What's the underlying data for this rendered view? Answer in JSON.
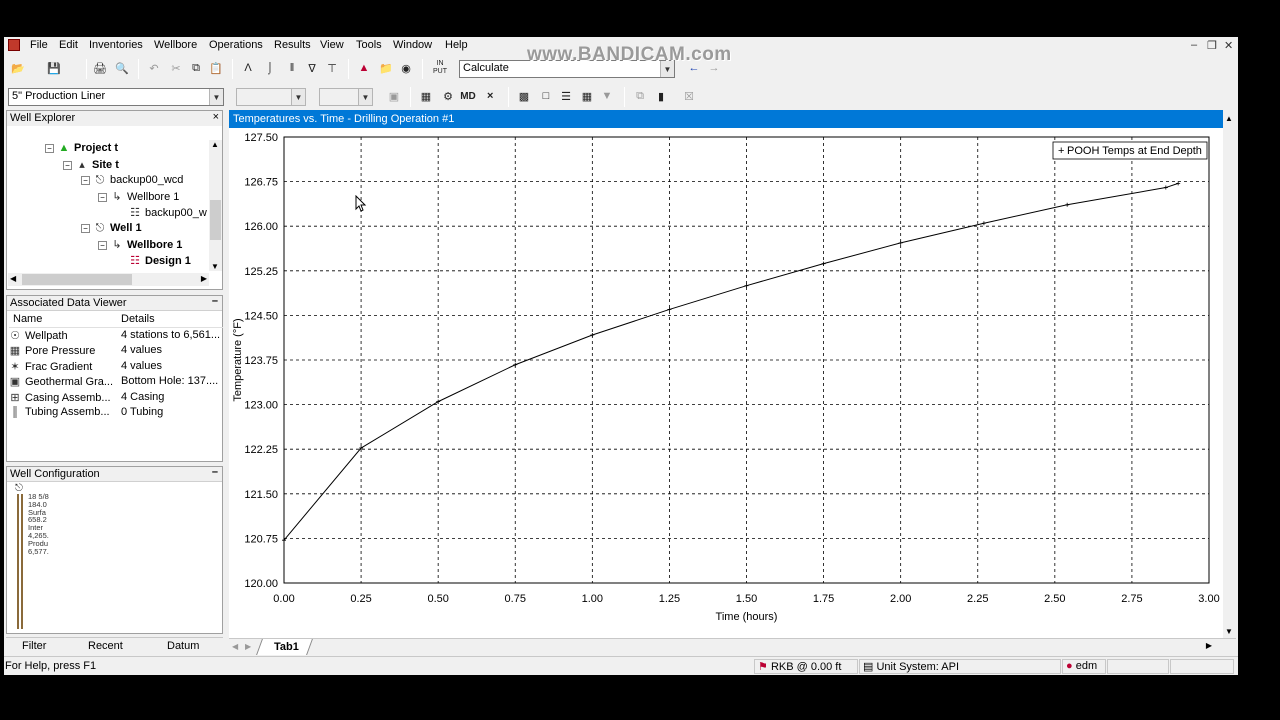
{
  "watermark": "www.BANDICAM.com",
  "menu": [
    "File",
    "Edit",
    "Inventories",
    "Wellbore",
    "Operations",
    "Results",
    "View",
    "Tools",
    "Window",
    "Help"
  ],
  "toolbar": {
    "calc_combo": "Calculate",
    "design_combo": "5\" Production Liner",
    "empty_combo_1": "",
    "empty_combo_2": "",
    "input_label": "IN PUT",
    "md_label": "MD"
  },
  "well_explorer": {
    "title": "Well Explorer",
    "nodes": [
      {
        "label": "Project t",
        "bold": true
      },
      {
        "label": "Site t",
        "bold": true
      },
      {
        "label": "backup00_wcd",
        "bold": false
      },
      {
        "label": "Wellbore 1",
        "bold": false
      },
      {
        "label": "backup00_w",
        "bold": false
      },
      {
        "label": "Well 1",
        "bold": true
      },
      {
        "label": "Wellbore 1",
        "bold": true
      },
      {
        "label": "Design 1",
        "bold": true
      }
    ]
  },
  "associated_data_viewer": {
    "title": "Associated Data Viewer",
    "col_name": "Name",
    "col_details": "Details",
    "rows": [
      {
        "name": "Wellpath",
        "details": "4 stations to 6,561....",
        "icon": "wellpath-icon"
      },
      {
        "name": "Pore Pressure",
        "details": "4 values",
        "icon": "pressure-icon"
      },
      {
        "name": "Frac Gradient",
        "details": "4 values",
        "icon": "frac-icon"
      },
      {
        "name": "Geothermal Gra...",
        "details": "Bottom Hole: 137....",
        "icon": "geothermal-icon"
      },
      {
        "name": "Casing Assemb...",
        "details": "4 Casing",
        "icon": "casing-icon"
      },
      {
        "name": "Tubing Assemb...",
        "details": "0 Tubing",
        "icon": "tubing-icon"
      }
    ]
  },
  "well_configuration": {
    "title": "Well Configuration",
    "labels": [
      "18 5/8",
      "184.0",
      "Surfa",
      "658.2",
      "Inter",
      "4,265.",
      "Produ",
      "6,577."
    ]
  },
  "bottom_tabs": [
    "Filter",
    "Recent",
    "Datum"
  ],
  "chart_window": {
    "title": "Temperatures vs. Time - Drilling Operation #1",
    "sheet_tab": "Tab1"
  },
  "chart_data": {
    "type": "line",
    "xlabel": "Time (hours)",
    "ylabel": "Temperature (°F)",
    "xlim": [
      0,
      3
    ],
    "ylim": [
      120,
      127.5
    ],
    "x_ticks": [
      "0.00",
      "0.25",
      "0.50",
      "0.75",
      "1.00",
      "1.25",
      "1.50",
      "1.75",
      "2.00",
      "2.25",
      "2.50",
      "2.75",
      "3.00"
    ],
    "y_ticks": [
      "120.00",
      "120.75",
      "121.50",
      "122.25",
      "123.00",
      "123.75",
      "124.50",
      "125.25",
      "126.00",
      "126.75",
      "127.50"
    ],
    "grid": true,
    "legend_position": "top-right",
    "series": [
      {
        "name": "POOH Temps at End Depth",
        "x": [
          0.0,
          0.25,
          0.5,
          0.75,
          1.0,
          1.25,
          1.5,
          1.75,
          2.0,
          2.27,
          2.54,
          2.86,
          2.9
        ],
        "y": [
          120.72,
          122.27,
          123.05,
          123.67,
          124.17,
          124.6,
          125.0,
          125.37,
          125.72,
          126.05,
          126.36,
          126.65,
          126.72
        ]
      }
    ]
  },
  "statusbar": {
    "help": "For Help, press F1",
    "rkb": "RKB @ 0.00 ft",
    "units": "Unit System: API",
    "user": "edm"
  }
}
